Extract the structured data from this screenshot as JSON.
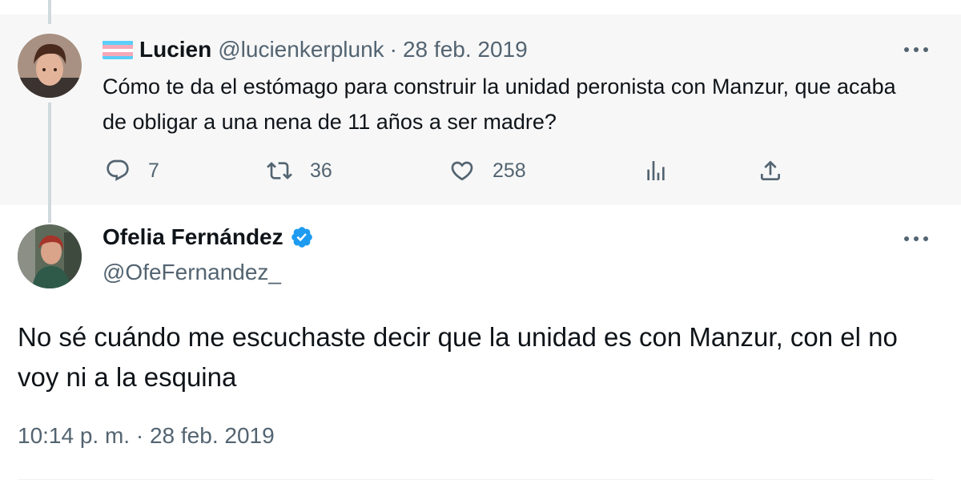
{
  "reply_tweet": {
    "author_name": "Lucien",
    "author_handle": "@lucienkerplunk",
    "separator": "·",
    "date": "28 feb. 2019",
    "flag_icon": "trans-pride-flag-icon",
    "text": "Cómo te da el estómago para construir la unidad peronista con Manzur, que acaba de obligar a una nena de 11 años a ser madre?",
    "actions": {
      "reply_count": "7",
      "retweet_count": "36",
      "like_count": "258"
    }
  },
  "main_tweet": {
    "author_name": "Ofelia Fernández",
    "author_handle": "@OfeFernandez_",
    "verified": true,
    "text": "No sé cuándo me escuchaste decir que la unidad es con Manzur, con el no voy ni a la esquina",
    "timestamp": "10:14 p. m. · 28 feb. 2019"
  },
  "colors": {
    "text": "#0f1419",
    "secondary": "#536471",
    "verified_blue": "#1d9bf0",
    "reply_background": "#f7f7f7",
    "thread_line": "#cfd9de"
  }
}
